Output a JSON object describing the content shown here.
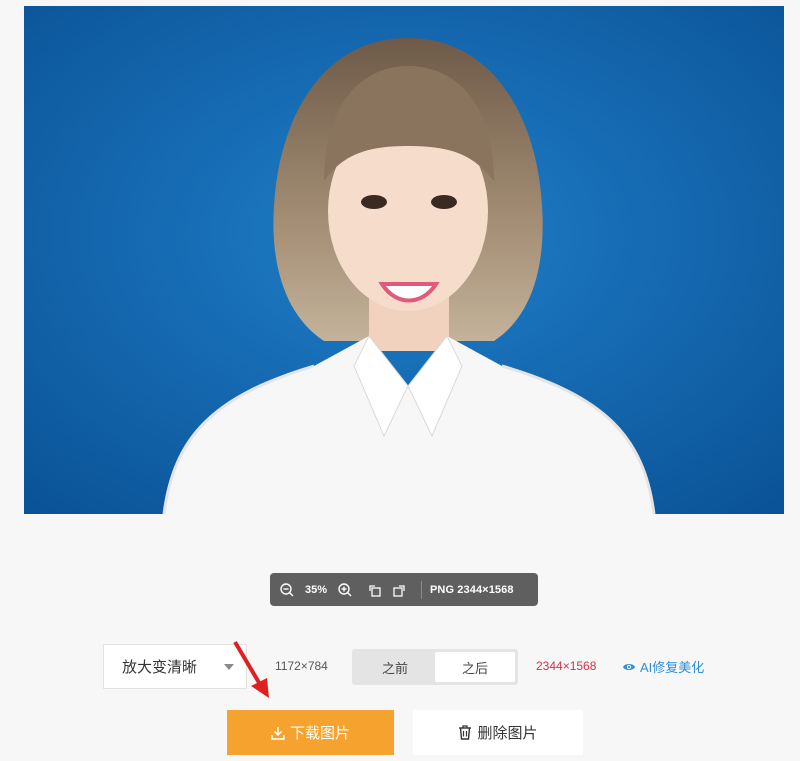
{
  "preview": {
    "image": "portrait-photo"
  },
  "toolbar": {
    "zoom": "35%",
    "image_info": "PNG 2344×1568",
    "icons": [
      "zoom-out-icon",
      "zoom-in-icon",
      "rotate-left-icon",
      "rotate-right-icon"
    ]
  },
  "controls": {
    "mode_select": "放大变清晰",
    "size_before": "1172×784",
    "compare_tabs": [
      "之前",
      "之后"
    ],
    "active_tab": "之后",
    "size_after": "2344×1568",
    "ai_link": "AI修复美化"
  },
  "actions": {
    "download": "下载图片",
    "delete": "删除图片"
  },
  "colors": {
    "accent": "#f6a22e",
    "size_after": "#d0334a",
    "link": "#2f8fd6"
  }
}
